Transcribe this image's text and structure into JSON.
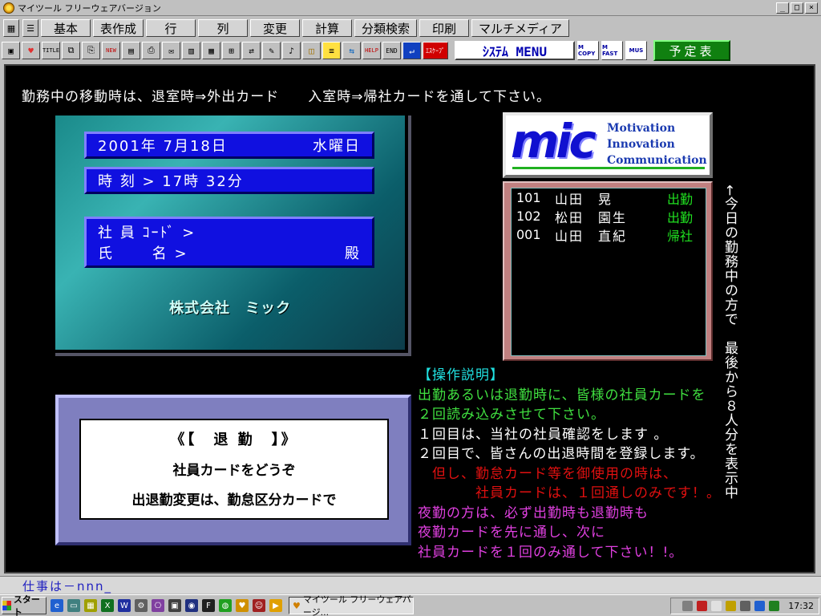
{
  "window": {
    "title": "マイツール フリーウェアバージョン",
    "controls": [
      "_",
      "□",
      "×"
    ]
  },
  "menu": {
    "tabs": [
      "基本",
      "表作成",
      "行",
      "列",
      "変更",
      "計算",
      "分類検索",
      "印刷",
      "マルチメディア"
    ]
  },
  "toolbar": {
    "system_menu": "ｼｽﾃﾑ MENU",
    "m_copy": "M COPY",
    "m_fast": "M FAST",
    "mus": "MUS",
    "schedule": "予定表",
    "help": "HELP",
    "end": "END",
    "esc": "ｴｽｹｰﾌﾟ",
    "title_icon": "TITLE",
    "new_icon": "NEW"
  },
  "notice": "勤務中の移動時は、退室時⇒外出カード　　入室時⇒帰社カードを通して下さい。",
  "info": {
    "date": "2001年 7月18日",
    "weekday": "水曜日",
    "time": "時 刻 > 17時 32分",
    "employee_code_label": "社 員 ｺｰﾄﾞ >",
    "name_label": "氏　　 名 >",
    "name_suffix": "殿",
    "company": "株式会社　ミック"
  },
  "card": {
    "mode": "《【　退 勤　】》",
    "prompt": "社員カードをどうぞ",
    "change_note": "出退勤変更は、勤怠区分カードで"
  },
  "logo": {
    "mark": "mic",
    "words": [
      "Motivation",
      "Innovation",
      "Communication"
    ]
  },
  "attendance": [
    {
      "code": "101",
      "name": "山田　晃",
      "status": "出勤"
    },
    {
      "code": "102",
      "name": "松田　園生",
      "status": "出勤"
    },
    {
      "code": "001",
      "name": "山田　直紀",
      "status": "帰社"
    }
  ],
  "side_note": "←今日の勤務中の方で　最後から８人分を表示中",
  "instructions": {
    "heading": "【操作説明】",
    "lines": [
      "出勤あるいは退勤時に、皆様の社員カードを",
      "２回読み込みさせて下さい。",
      "１回目は、当社の社員確認をします 。",
      "２回目で、皆さんの出退時間を登録します。",
      "　但し、勤怠カード等を御使用の時は、",
      "　　　　社員カードは、１回通しのみです！。",
      "夜勤の方は、必ず出勤時も退勤時も",
      "夜勤カードを先に通し、次に",
      "社員カードを１回のみ通して下さい！!。"
    ]
  },
  "status_line": "仕事は－nnn_",
  "taskbar": {
    "start": "スタート",
    "task": "マイツール フリーウェアバージ...",
    "clock": "17:32"
  },
  "colors": {
    "main_bg": "#000000",
    "info_panel": "#2aa0a0",
    "date_bar": "#1010e0",
    "card_panel": "#7f7fbf",
    "logo_blue": "#1010d0",
    "status_green": "#20e020"
  }
}
